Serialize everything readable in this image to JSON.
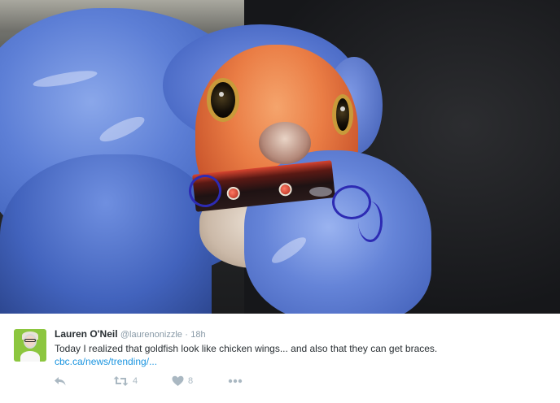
{
  "tweet": {
    "media": {
      "alt": ""
    },
    "author": {
      "name": "Lauren O'Neil",
      "handle": "@laurenonizzle",
      "separator": "·",
      "time": "18h"
    },
    "text": "Today I realized that goldfish look like chicken wings... and also that they can get braces.",
    "link": "cbc.ca/news/trending/...",
    "actions": {
      "reply": {
        "icon": "reply-icon"
      },
      "retweet": {
        "icon": "retweet-icon",
        "count": "4"
      },
      "like": {
        "icon": "heart-icon",
        "count": "8"
      },
      "more": {
        "icon": "more-dots-icon"
      }
    }
  }
}
